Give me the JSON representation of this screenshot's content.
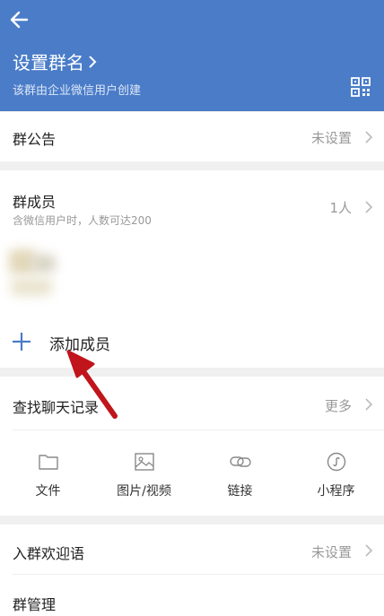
{
  "header": {
    "title": "设置群名",
    "subtitle": "该群由企业微信用户创建",
    "back_icon": "back-arrow-icon",
    "qr_icon": "qr-code-icon",
    "bg_color": "#4a7cc8"
  },
  "notice": {
    "label": "群公告",
    "value": "未设置"
  },
  "members": {
    "label": "群成员",
    "hint": "含微信用户时，人数可达200",
    "count": "1人",
    "add_label": "添加成员"
  },
  "chat_history": {
    "label": "查找聊天记录",
    "more": "更多",
    "items": [
      {
        "label": "文件",
        "icon": "folder-icon"
      },
      {
        "label": "图片/视频",
        "icon": "image-icon"
      },
      {
        "label": "链接",
        "icon": "link-icon"
      },
      {
        "label": "小程序",
        "icon": "mini-program-icon"
      }
    ]
  },
  "welcome": {
    "label": "入群欢迎语",
    "value": "未设置"
  },
  "manage": {
    "label": "群管理"
  },
  "colors": {
    "accent": "#4a7cc8",
    "annotation_arrow": "#c0151b"
  }
}
